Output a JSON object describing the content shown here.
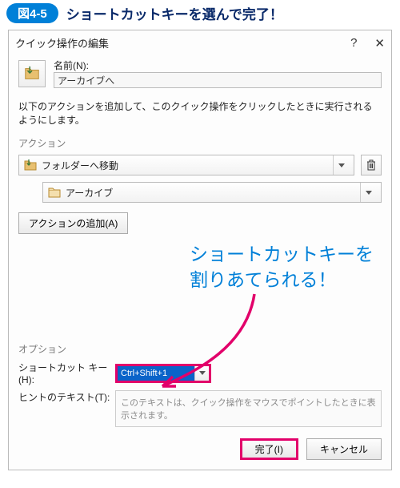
{
  "figure": {
    "badge": "図4-5",
    "title": "ショートカットキーを選んで完了！"
  },
  "dialog": {
    "title": "クイック操作の編集",
    "help_glyph": "?",
    "close_glyph": "✕",
    "name_label": "名前(N):",
    "name_value": "アーカイブへ",
    "instruction": "以下のアクションを追加して、このクイック操作をクリックしたときに実行されるようにします。",
    "section_action": "アクション",
    "action_dropdown": "フォルダーへ移動",
    "nested_dropdown": "アーカイブ",
    "add_action": "アクションの追加(A)",
    "annotation_line1": "ショートカットキーを",
    "annotation_line2": "割りあてられる！",
    "section_options": "オプション",
    "shortcut_label": "ショートカット キー(H):",
    "shortcut_value": "Ctrl+Shift+1",
    "hint_label": "ヒントのテキスト(T):",
    "hint_placeholder": "このテキストは、クイック操作をマウスでポイントしたときに表示されます。",
    "finish_btn": "完了(I)",
    "cancel_btn": "キャンセル"
  }
}
